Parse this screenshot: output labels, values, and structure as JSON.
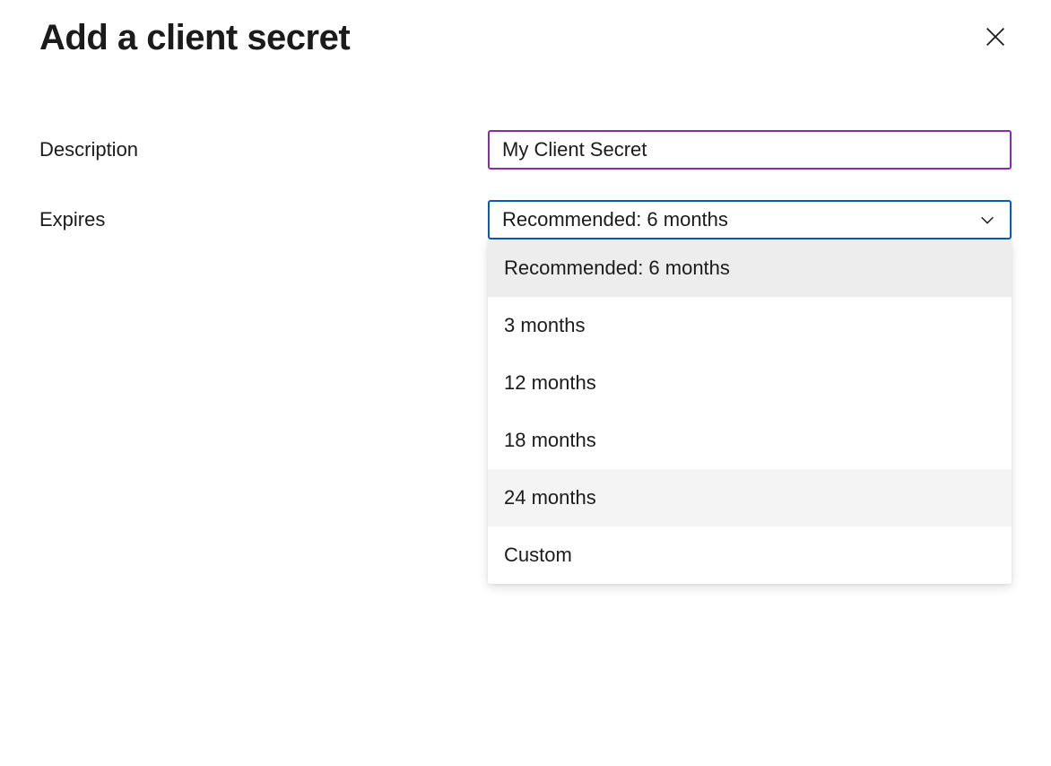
{
  "panel": {
    "title": "Add a client secret"
  },
  "form": {
    "description": {
      "label": "Description",
      "value": "My Client Secret"
    },
    "expires": {
      "label": "Expires",
      "selected": "Recommended: 6 months",
      "options": [
        {
          "label": "Recommended: 6 months",
          "state": "selected"
        },
        {
          "label": "3 months",
          "state": ""
        },
        {
          "label": "12 months",
          "state": ""
        },
        {
          "label": "18 months",
          "state": ""
        },
        {
          "label": "24 months",
          "state": "hovered"
        },
        {
          "label": "Custom",
          "state": ""
        }
      ]
    }
  }
}
